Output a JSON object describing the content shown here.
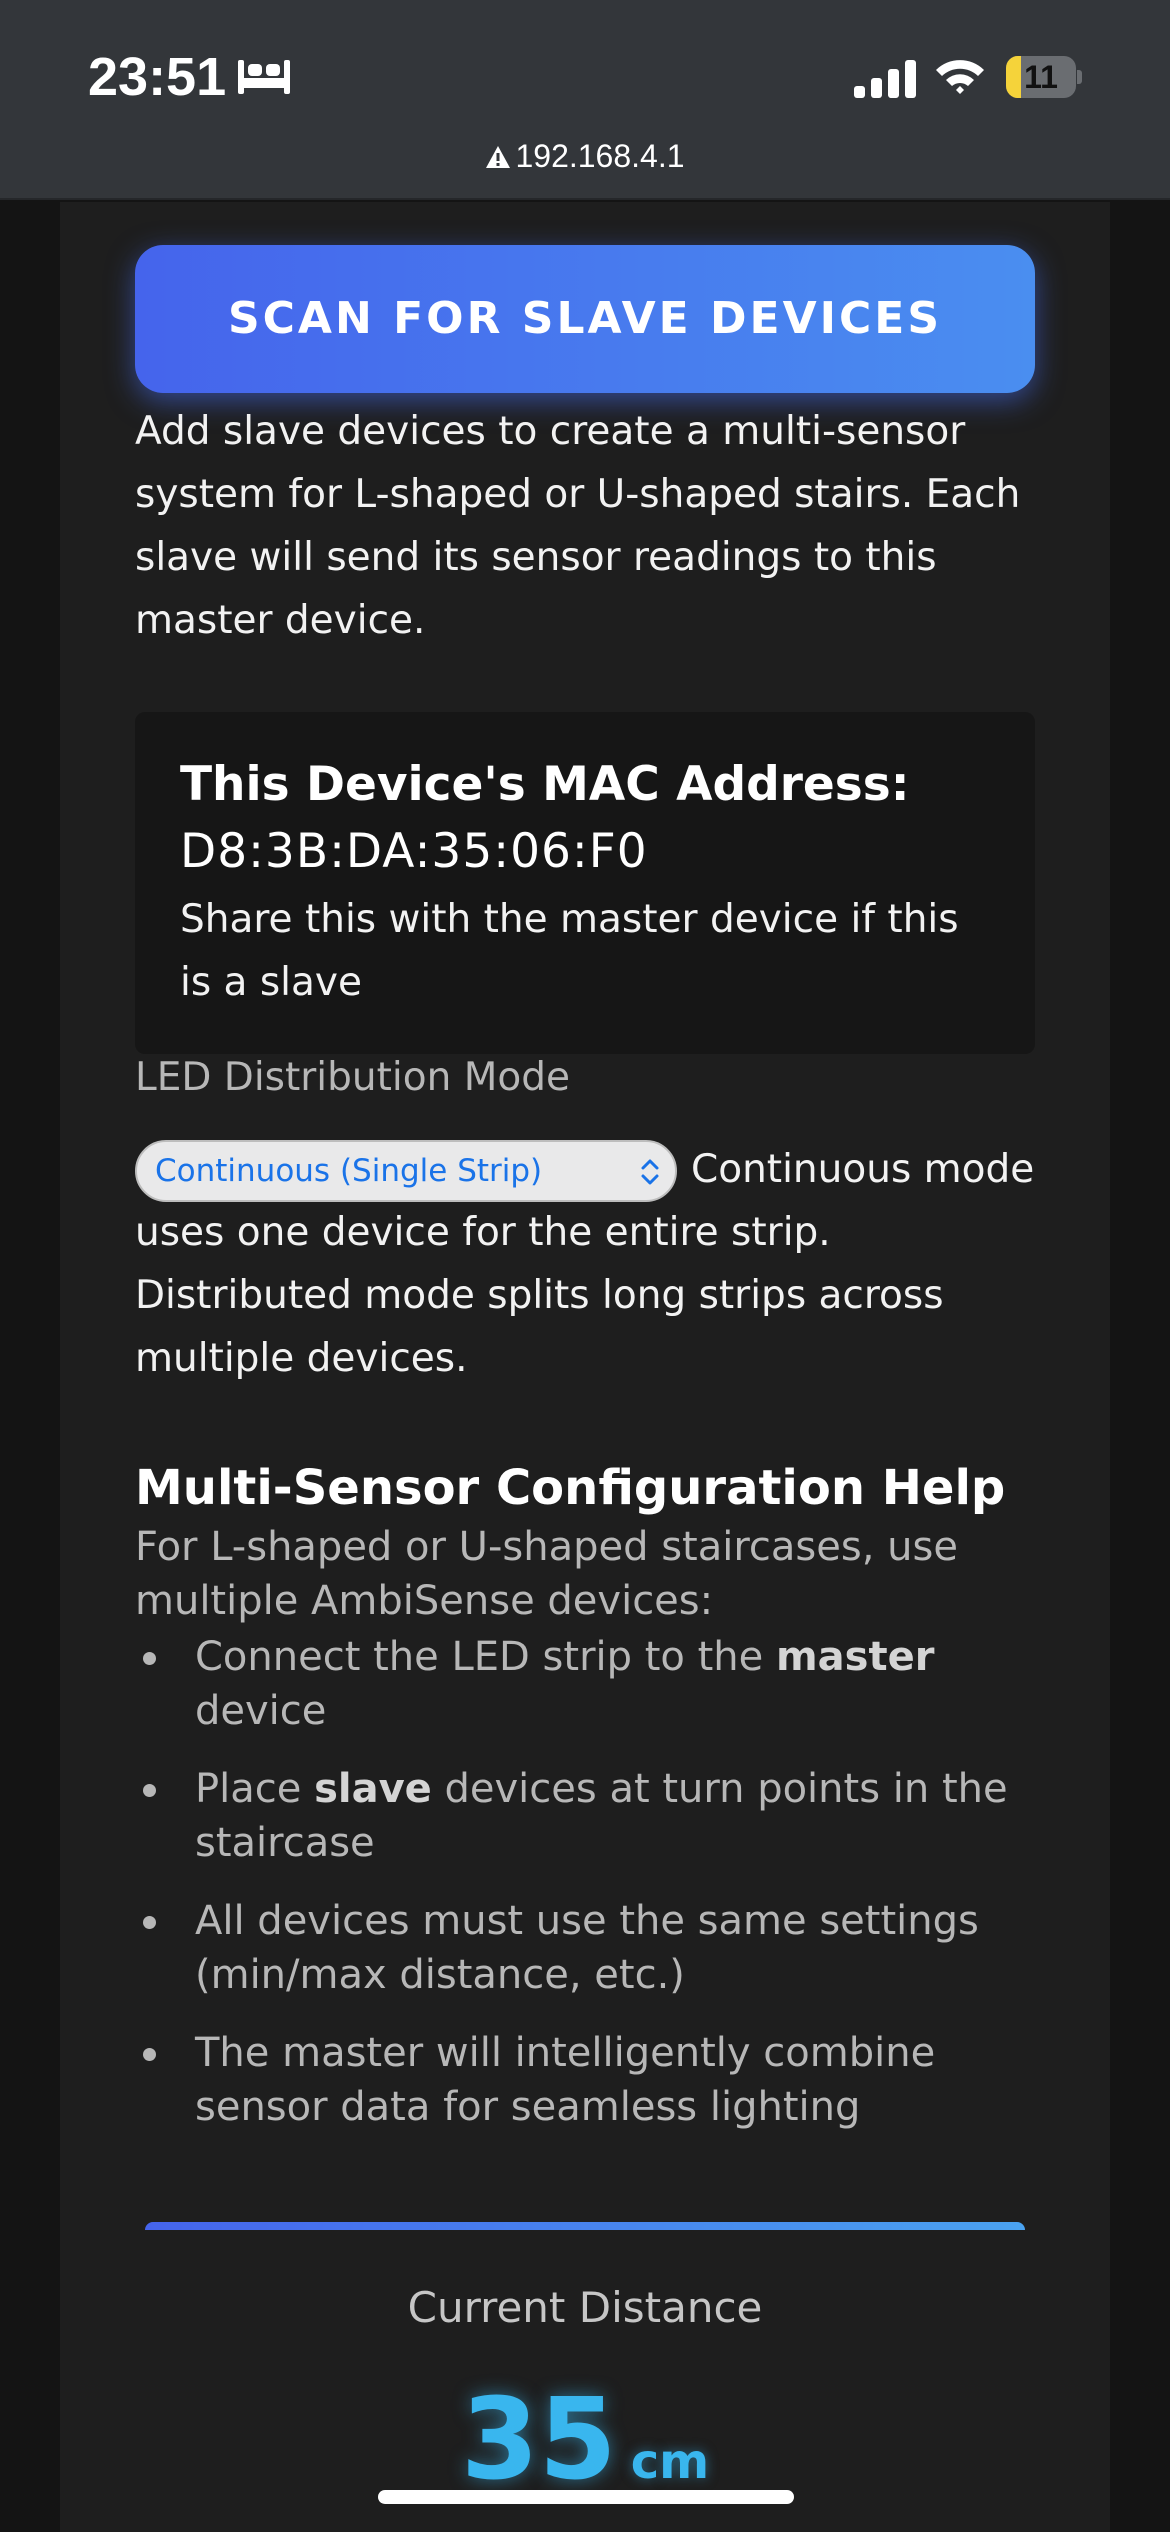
{
  "status_bar": {
    "time": "23:51",
    "battery_level": "11",
    "battery_fraction": 0.11,
    "icons": [
      "bed-icon",
      "cellular-signal-icon",
      "wifi-icon",
      "battery-icon"
    ]
  },
  "browser": {
    "url": "192.168.4.1",
    "security_icon": "warning-icon"
  },
  "scan_button": {
    "label": "SCAN FOR SLAVE DEVICES"
  },
  "intro_text": "Add slave devices to create a multi-sensor system for L-shaped or U-shaped stairs. Each slave will send its sensor readings to this master device.",
  "mac_box": {
    "title": "This Device's MAC Address:",
    "value": "D8:3B:DA:35:06:F0",
    "note": "Share this with the master device if this is a slave"
  },
  "led_mode": {
    "label": "LED Distribution Mode",
    "selected": "Continuous (Single Strip)",
    "description": "Continuous mode uses one device for the entire strip. Distributed mode splits long strips across multiple devices."
  },
  "help": {
    "title": "Multi-Sensor Configuration Help",
    "intro": "For L-shaped or U-shaped staircases, use multiple AmbiSense devices:",
    "items": [
      {
        "pre": "Connect the LED strip to the ",
        "bold": "master",
        "post": " device"
      },
      {
        "pre": "Place ",
        "bold": "slave",
        "post": " devices at turn points in the staircase"
      },
      {
        "pre": "All devices must use the same settings (min/max distance, etc.)",
        "bold": "",
        "post": ""
      },
      {
        "pre": "The master will intelligently combine sensor data for seamless lighting",
        "bold": "",
        "post": ""
      }
    ]
  },
  "distance": {
    "label": "Current Distance",
    "value": "35",
    "unit": "cm"
  },
  "colors": {
    "accent_start": "#4564ec",
    "accent_end": "#4a8ef0",
    "distance": "#39b6ee",
    "background": "#1e1e1e"
  }
}
